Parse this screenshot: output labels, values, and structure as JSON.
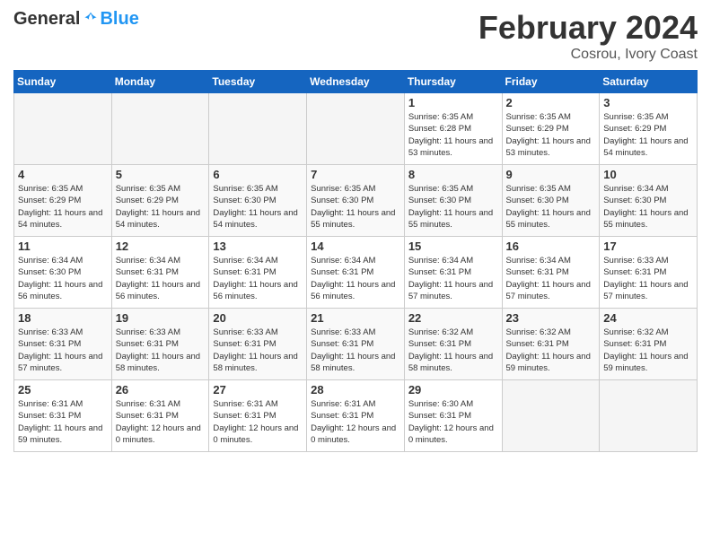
{
  "header": {
    "logo": {
      "general": "General",
      "blue": "Blue"
    },
    "title": "February 2024",
    "subtitle": "Cosrou, Ivory Coast"
  },
  "calendar": {
    "days_of_week": [
      "Sunday",
      "Monday",
      "Tuesday",
      "Wednesday",
      "Thursday",
      "Friday",
      "Saturday"
    ],
    "weeks": [
      [
        {
          "day": "",
          "info": ""
        },
        {
          "day": "",
          "info": ""
        },
        {
          "day": "",
          "info": ""
        },
        {
          "day": "",
          "info": ""
        },
        {
          "day": "1",
          "info": "Sunrise: 6:35 AM\nSunset: 6:28 PM\nDaylight: 11 hours\nand 53 minutes."
        },
        {
          "day": "2",
          "info": "Sunrise: 6:35 AM\nSunset: 6:29 PM\nDaylight: 11 hours\nand 53 minutes."
        },
        {
          "day": "3",
          "info": "Sunrise: 6:35 AM\nSunset: 6:29 PM\nDaylight: 11 hours\nand 54 minutes."
        }
      ],
      [
        {
          "day": "4",
          "info": "Sunrise: 6:35 AM\nSunset: 6:29 PM\nDaylight: 11 hours\nand 54 minutes."
        },
        {
          "day": "5",
          "info": "Sunrise: 6:35 AM\nSunset: 6:29 PM\nDaylight: 11 hours\nand 54 minutes."
        },
        {
          "day": "6",
          "info": "Sunrise: 6:35 AM\nSunset: 6:30 PM\nDaylight: 11 hours\nand 54 minutes."
        },
        {
          "day": "7",
          "info": "Sunrise: 6:35 AM\nSunset: 6:30 PM\nDaylight: 11 hours\nand 55 minutes."
        },
        {
          "day": "8",
          "info": "Sunrise: 6:35 AM\nSunset: 6:30 PM\nDaylight: 11 hours\nand 55 minutes."
        },
        {
          "day": "9",
          "info": "Sunrise: 6:35 AM\nSunset: 6:30 PM\nDaylight: 11 hours\nand 55 minutes."
        },
        {
          "day": "10",
          "info": "Sunrise: 6:34 AM\nSunset: 6:30 PM\nDaylight: 11 hours\nand 55 minutes."
        }
      ],
      [
        {
          "day": "11",
          "info": "Sunrise: 6:34 AM\nSunset: 6:30 PM\nDaylight: 11 hours\nand 56 minutes."
        },
        {
          "day": "12",
          "info": "Sunrise: 6:34 AM\nSunset: 6:31 PM\nDaylight: 11 hours\nand 56 minutes."
        },
        {
          "day": "13",
          "info": "Sunrise: 6:34 AM\nSunset: 6:31 PM\nDaylight: 11 hours\nand 56 minutes."
        },
        {
          "day": "14",
          "info": "Sunrise: 6:34 AM\nSunset: 6:31 PM\nDaylight: 11 hours\nand 56 minutes."
        },
        {
          "day": "15",
          "info": "Sunrise: 6:34 AM\nSunset: 6:31 PM\nDaylight: 11 hours\nand 57 minutes."
        },
        {
          "day": "16",
          "info": "Sunrise: 6:34 AM\nSunset: 6:31 PM\nDaylight: 11 hours\nand 57 minutes."
        },
        {
          "day": "17",
          "info": "Sunrise: 6:33 AM\nSunset: 6:31 PM\nDaylight: 11 hours\nand 57 minutes."
        }
      ],
      [
        {
          "day": "18",
          "info": "Sunrise: 6:33 AM\nSunset: 6:31 PM\nDaylight: 11 hours\nand 57 minutes."
        },
        {
          "day": "19",
          "info": "Sunrise: 6:33 AM\nSunset: 6:31 PM\nDaylight: 11 hours\nand 58 minutes."
        },
        {
          "day": "20",
          "info": "Sunrise: 6:33 AM\nSunset: 6:31 PM\nDaylight: 11 hours\nand 58 minutes."
        },
        {
          "day": "21",
          "info": "Sunrise: 6:33 AM\nSunset: 6:31 PM\nDaylight: 11 hours\nand 58 minutes."
        },
        {
          "day": "22",
          "info": "Sunrise: 6:32 AM\nSunset: 6:31 PM\nDaylight: 11 hours\nand 58 minutes."
        },
        {
          "day": "23",
          "info": "Sunrise: 6:32 AM\nSunset: 6:31 PM\nDaylight: 11 hours\nand 59 minutes."
        },
        {
          "day": "24",
          "info": "Sunrise: 6:32 AM\nSunset: 6:31 PM\nDaylight: 11 hours\nand 59 minutes."
        }
      ],
      [
        {
          "day": "25",
          "info": "Sunrise: 6:31 AM\nSunset: 6:31 PM\nDaylight: 11 hours\nand 59 minutes."
        },
        {
          "day": "26",
          "info": "Sunrise: 6:31 AM\nSunset: 6:31 PM\nDaylight: 12 hours\nand 0 minutes."
        },
        {
          "day": "27",
          "info": "Sunrise: 6:31 AM\nSunset: 6:31 PM\nDaylight: 12 hours\nand 0 minutes."
        },
        {
          "day": "28",
          "info": "Sunrise: 6:31 AM\nSunset: 6:31 PM\nDaylight: 12 hours\nand 0 minutes."
        },
        {
          "day": "29",
          "info": "Sunrise: 6:30 AM\nSunset: 6:31 PM\nDaylight: 12 hours\nand 0 minutes."
        },
        {
          "day": "",
          "info": ""
        },
        {
          "day": "",
          "info": ""
        }
      ]
    ]
  }
}
